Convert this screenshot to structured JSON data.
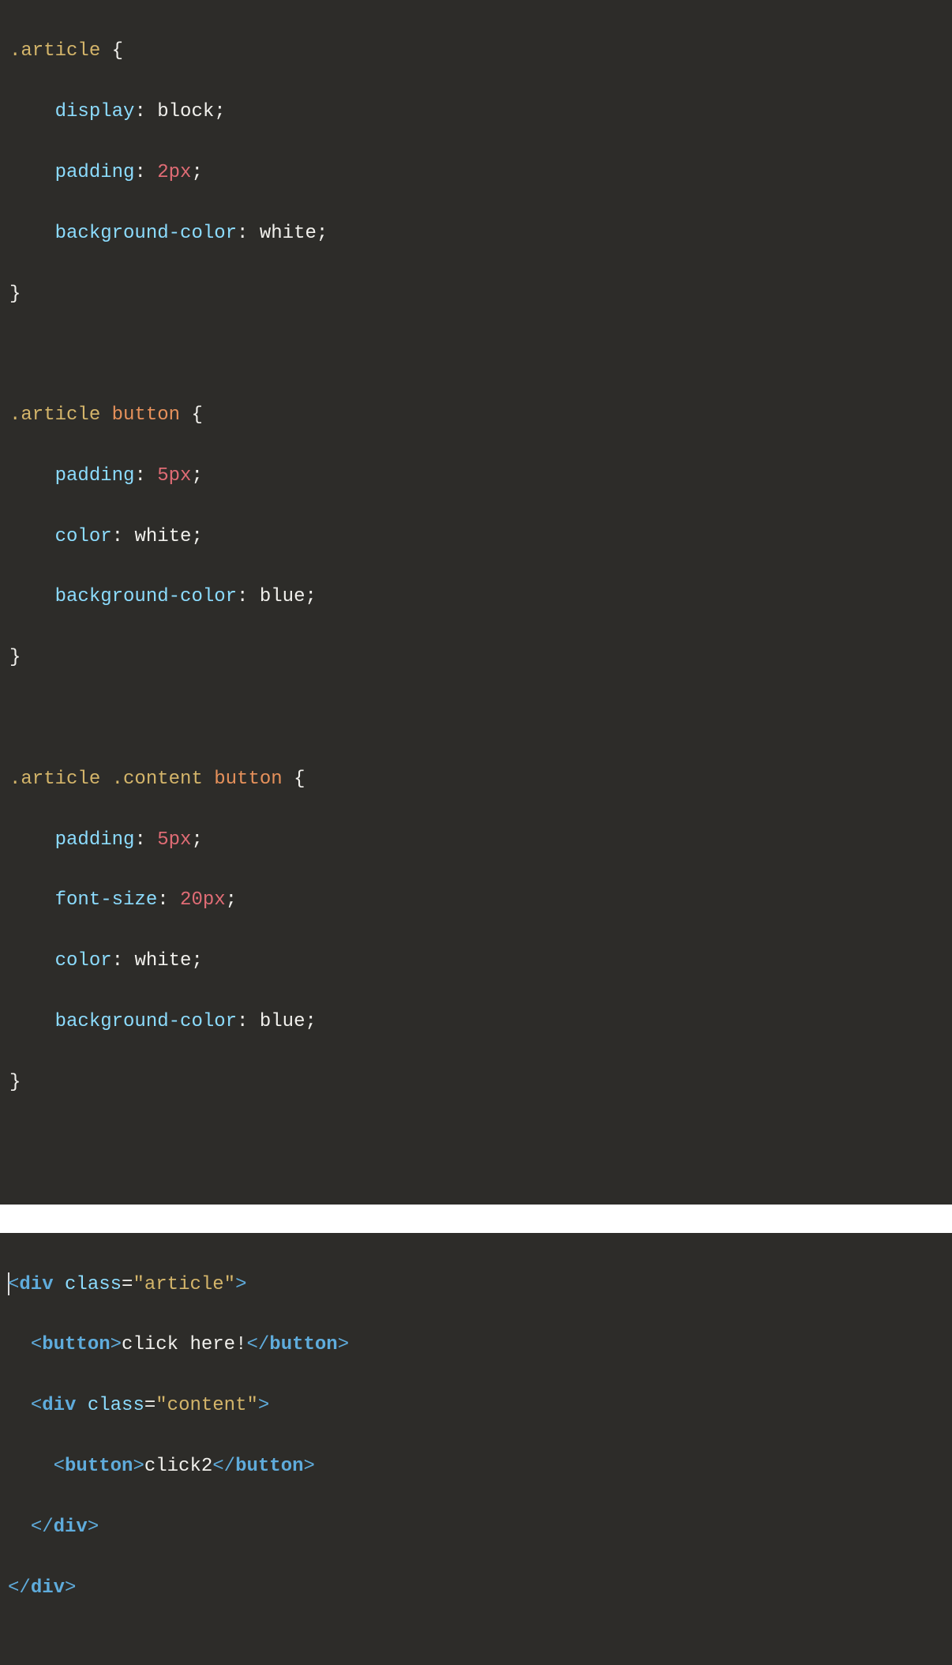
{
  "css": {
    "rule1": {
      "selector": ".article",
      "open": "{",
      "close": "}",
      "decl1": {
        "prop": "display",
        "colon": ":",
        "value": "block",
        "semi": ";"
      },
      "decl2": {
        "prop": "padding",
        "colon": ":",
        "value": "2px",
        "semi": ";"
      },
      "decl3": {
        "prop": "background-color",
        "colon": ":",
        "value": "white",
        "semi": ";"
      }
    },
    "rule2": {
      "selector_class": ".article",
      "selector_tag": "button",
      "open": "{",
      "close": "}",
      "decl1": {
        "prop": "padding",
        "colon": ":",
        "value": "5px",
        "semi": ";"
      },
      "decl2": {
        "prop": "color",
        "colon": ":",
        "value": "white",
        "semi": ";"
      },
      "decl3": {
        "prop": "background-color",
        "colon": ":",
        "value": "blue",
        "semi": ";"
      }
    },
    "rule3": {
      "selector_class1": ".article",
      "selector_class2": ".content",
      "selector_tag": "button",
      "open": "{",
      "close": "}",
      "decl1": {
        "prop": "padding",
        "colon": ":",
        "value": "5px",
        "semi": ";"
      },
      "decl2": {
        "prop": "font-size",
        "colon": ":",
        "value": "20px",
        "semi": ";"
      },
      "decl3": {
        "prop": "color",
        "colon": ":",
        "value": "white",
        "semi": ";"
      },
      "decl4": {
        "prop": "background-color",
        "colon": ":",
        "value": "blue",
        "semi": ";"
      }
    }
  },
  "html": {
    "line1": {
      "open_lt": "<",
      "tag": "div",
      "attr_name": "class",
      "eq": "=",
      "attr_value": "\"article\"",
      "close_gt": ">"
    },
    "line2": {
      "open_lt": "<",
      "tag": "button",
      "close_gt": ">",
      "text": "click here!",
      "close_open": "</",
      "close_tag": "button",
      "close_close": ">"
    },
    "line3": {
      "open_lt": "<",
      "tag": "div",
      "attr_name": "class",
      "eq": "=",
      "attr_value": "\"content\"",
      "close_gt": ">"
    },
    "line4": {
      "open_lt": "<",
      "tag": "button",
      "close_gt": ">",
      "text": "click2",
      "close_open": "</",
      "close_tag": "button",
      "close_close": ">"
    },
    "line5": {
      "close_open": "</",
      "close_tag": "div",
      "close_close": ">"
    },
    "line6": {
      "close_open": "</",
      "close_tag": "div",
      "close_close": ">"
    }
  }
}
